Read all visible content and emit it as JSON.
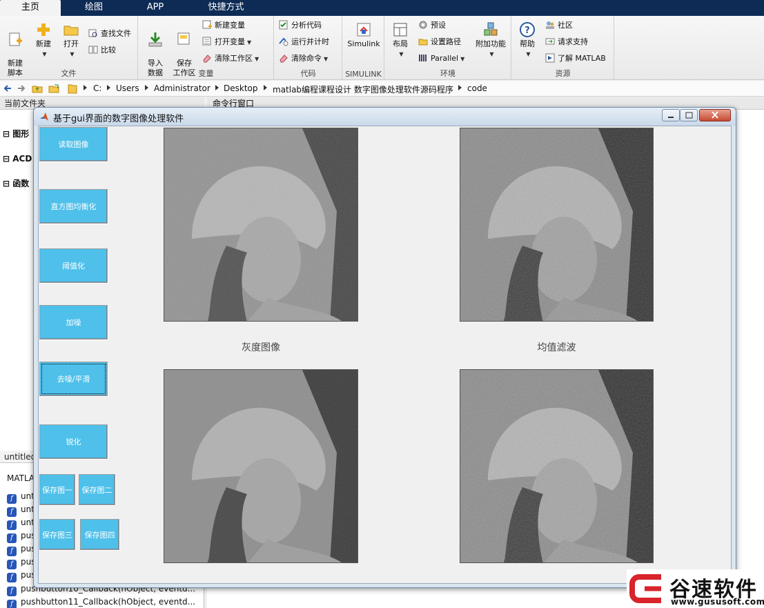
{
  "tabs": [
    "主页",
    "绘图",
    "APP",
    "快捷方式"
  ],
  "ribbon": {
    "file": {
      "label": "文件",
      "new_script": "新建\n脚本",
      "new": "新建",
      "open": "打开",
      "find_files": "查找文件",
      "compare": "比较"
    },
    "variable": {
      "label": "变量",
      "import": "导入\n数据",
      "save_workspace": "保存\n工作区",
      "new_variable": "新建变量",
      "open_variable": "打开变量",
      "clear_workspace": "清除工作区"
    },
    "code": {
      "label": "代码",
      "analyze": "分析代码",
      "run_time": "运行并计时",
      "clear_commands": "清除命令"
    },
    "simulink": {
      "label": "SIMULINK",
      "button": "Simulink"
    },
    "env": {
      "label": "环境",
      "layout": "布局",
      "preferences": "预设",
      "set_path": "设置路径",
      "parallel": "Parallel",
      "addons": "附加功能"
    },
    "resources": {
      "label": "资源",
      "help": "帮助",
      "community": "社区",
      "support": "请求支持",
      "learn": "了解 MATLAB"
    }
  },
  "address": {
    "crumbs": [
      "C:",
      "Users",
      "Administrator",
      "Desktop",
      "matlab编程课程设计 数字图像处理软件源码程序",
      "code"
    ]
  },
  "left_panel": {
    "title": "当前文件夹",
    "sections": [
      "图形",
      "ACD",
      "函数"
    ],
    "bottom_tab": "untitled",
    "bottom_header": "MATLA",
    "files": [
      "unt",
      "unt",
      "unt",
      "pus",
      "pus",
      "pus",
      "pus",
      "pushbutton10_Callback(hObject, eventd...",
      "pushbutton11_Callback(hObject, eventd..."
    ]
  },
  "command_window": {
    "title": "命令行窗口"
  },
  "gui": {
    "title": "基于gui界面的数字图像处理软件",
    "buttons": {
      "read": "读取图像",
      "hist_eq": "直方图均衡化",
      "threshold": "阈值化",
      "noise": "加噪",
      "denoise": "去噪/平滑",
      "sharpen": "锐化",
      "save1": "保存图一",
      "save2": "保存图二",
      "save3": "保存图三",
      "save4": "保存图四"
    },
    "captions": {
      "img1": "灰度图像",
      "img2": "均值滤波"
    }
  },
  "watermark": {
    "name": "谷速软件",
    "url": "www.gususoft.com"
  },
  "colors": {
    "accent_button": "#4ec0ea",
    "tab_bar": "#0d2b55",
    "logo_red": "#d8242a"
  }
}
